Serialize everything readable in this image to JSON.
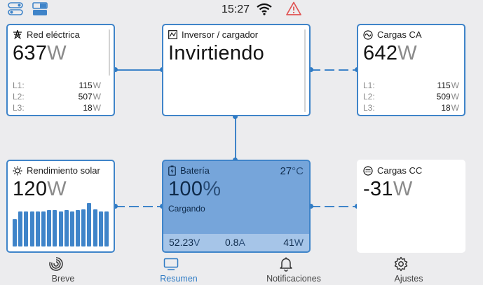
{
  "status_bar": {
    "time": "15:27",
    "icons": [
      "toggles-icon",
      "split-view-icon",
      "wifi-icon",
      "warning-icon"
    ],
    "warning_color": "#e05252"
  },
  "widgets": {
    "grid": {
      "title": "Red eléctrica",
      "icon": "pylon-icon",
      "value": "637",
      "unit": "W",
      "phases": [
        {
          "label": "L1:",
          "value": "115",
          "unit": "W"
        },
        {
          "label": "L2:",
          "value": "507",
          "unit": "W"
        },
        {
          "label": "L3:",
          "value": "18",
          "unit": "W"
        }
      ]
    },
    "inverter": {
      "title": "Inversor / cargador",
      "icon": "inverter-icon",
      "state": "Invirtiendo"
    },
    "ac_loads": {
      "title": "Cargas CA",
      "icon": "ac-wave-icon",
      "value": "642",
      "unit": "W",
      "phases": [
        {
          "label": "L1:",
          "value": "115",
          "unit": "W"
        },
        {
          "label": "L2:",
          "value": "509",
          "unit": "W"
        },
        {
          "label": "L3:",
          "value": "18",
          "unit": "W"
        }
      ]
    },
    "solar": {
      "title": "Rendimiento solar",
      "icon": "sun-icon",
      "value": "120",
      "unit": "W",
      "history": [
        0.55,
        0.72,
        0.72,
        0.72,
        0.72,
        0.72,
        0.74,
        0.74,
        0.72,
        0.74,
        0.72,
        0.74,
        0.76,
        0.88,
        0.76,
        0.72,
        0.72
      ]
    },
    "battery": {
      "title": "Batería",
      "icon": "battery-charging-icon",
      "temperature": "27",
      "temperature_unit": "°C",
      "soc": "100",
      "soc_unit": "%",
      "state": "Cargando",
      "voltage": "52.23",
      "voltage_unit": "V",
      "current": "0.8",
      "current_unit": "A",
      "power": "41",
      "power_unit": "W"
    },
    "dc_loads": {
      "title": "Cargas CC",
      "icon": "dc-icon",
      "value": "-31",
      "unit": "W"
    }
  },
  "nav": {
    "items": [
      {
        "label": "Breve",
        "icon": "brief-rings-icon",
        "active": false
      },
      {
        "label": "Resumen",
        "icon": "overview-screen-icon",
        "active": true
      },
      {
        "label": "Notificaciones",
        "icon": "bell-icon",
        "active": false
      },
      {
        "label": "Ajustes",
        "icon": "gear-icon",
        "active": false
      }
    ]
  },
  "colors": {
    "accent": "#3f84c9",
    "battery_fill": "#76a5da",
    "background": "#ececee"
  }
}
